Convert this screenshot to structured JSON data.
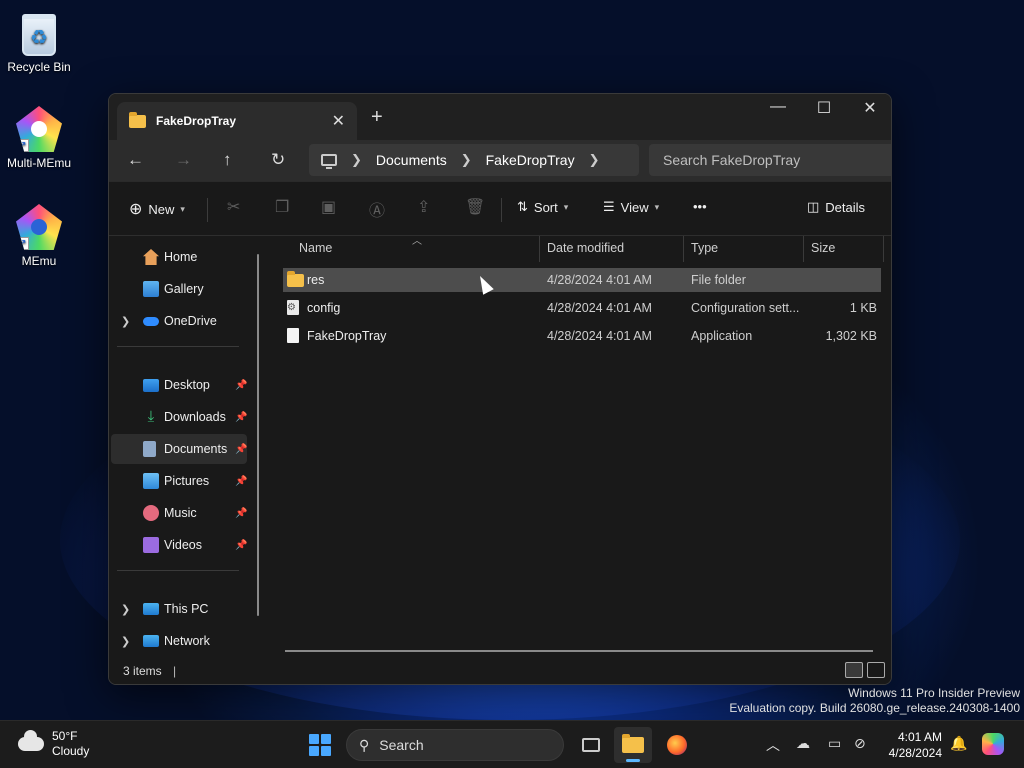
{
  "desktop": {
    "icons": [
      {
        "label": "Recycle Bin"
      },
      {
        "label": "Multi-MEmu"
      },
      {
        "label": "MEmu"
      }
    ]
  },
  "window": {
    "tab_title": "FakeDropTray",
    "address": {
      "crumbs": [
        "Documents",
        "FakeDropTray"
      ]
    },
    "search_placeholder": "Search FakeDropTray",
    "toolbar": {
      "new_label": "New",
      "sort_label": "Sort",
      "view_label": "View",
      "more_label": "•••",
      "details_label": "Details"
    },
    "sidebar": {
      "items": [
        {
          "label": "Home"
        },
        {
          "label": "Gallery"
        },
        {
          "label": "OneDrive"
        },
        {
          "label": "Desktop"
        },
        {
          "label": "Downloads"
        },
        {
          "label": "Documents"
        },
        {
          "label": "Pictures"
        },
        {
          "label": "Music"
        },
        {
          "label": "Videos"
        },
        {
          "label": "This PC"
        },
        {
          "label": "Network"
        }
      ]
    },
    "columns": {
      "name": "Name",
      "date": "Date modified",
      "type": "Type",
      "size": "Size"
    },
    "files": [
      {
        "name": "res",
        "date": "4/28/2024 4:01 AM",
        "type": "File folder",
        "size": ""
      },
      {
        "name": "config",
        "date": "4/28/2024 4:01 AM",
        "type": "Configuration sett...",
        "size": "1 KB"
      },
      {
        "name": "FakeDropTray",
        "date": "4/28/2024 4:01 AM",
        "type": "Application",
        "size": "1,302 KB"
      }
    ],
    "status": "3 items"
  },
  "watermark": {
    "line1": "Windows 11 Pro Insider Preview",
    "line2": "Evaluation copy. Build 26080.ge_release.240308-1400"
  },
  "taskbar": {
    "weather_temp": "50°F",
    "weather_cond": "Cloudy",
    "search_label": "Search",
    "time": "4:01 AM",
    "date": "4/28/2024"
  }
}
